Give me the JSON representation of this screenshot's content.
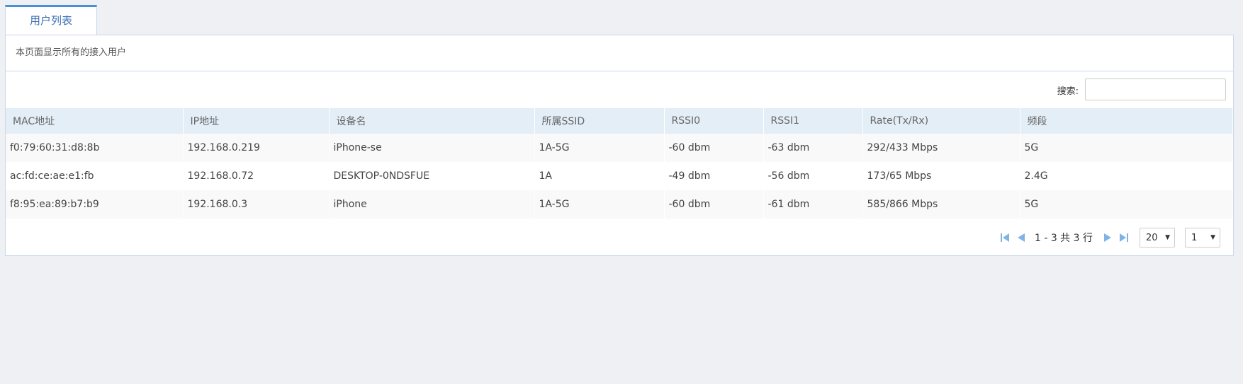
{
  "tab": {
    "label": "用户列表"
  },
  "panel": {
    "description": "本页面显示所有的接入用户",
    "search": {
      "label": "搜索:",
      "value": "",
      "placeholder": ""
    }
  },
  "table": {
    "columns": [
      "MAC地址",
      "IP地址",
      "设备名",
      "所属SSID",
      "RSSI0",
      "RSSI1",
      "Rate(Tx/Rx)",
      "频段"
    ],
    "rows": [
      [
        "f0:79:60:31:d8:8b",
        "192.168.0.219",
        "iPhone-se",
        "1A-5G",
        "-60 dbm",
        "-63 dbm",
        "292/433 Mbps",
        "5G"
      ],
      [
        "ac:fd:ce:ae:e1:fb",
        "192.168.0.72",
        "DESKTOP-0NDSFUE",
        "1A",
        "-49 dbm",
        "-56 dbm",
        "173/65 Mbps",
        "2.4G"
      ],
      [
        "f8:95:ea:89:b7:b9",
        "192.168.0.3",
        "iPhone",
        "1A-5G",
        "-60 dbm",
        "-61 dbm",
        "585/866 Mbps",
        "5G"
      ]
    ]
  },
  "pager": {
    "info": "1 - 3 共 3 行",
    "page_size": "20",
    "page": "1",
    "icons": [
      "first-page-icon",
      "prev-page-icon",
      "next-page-icon",
      "last-page-icon"
    ],
    "icon_color": "#7fb3e8"
  },
  "colors": {
    "accent": "#4a90d9",
    "header_bg": "#e3eef7",
    "page_bg": "#eff0f4"
  }
}
